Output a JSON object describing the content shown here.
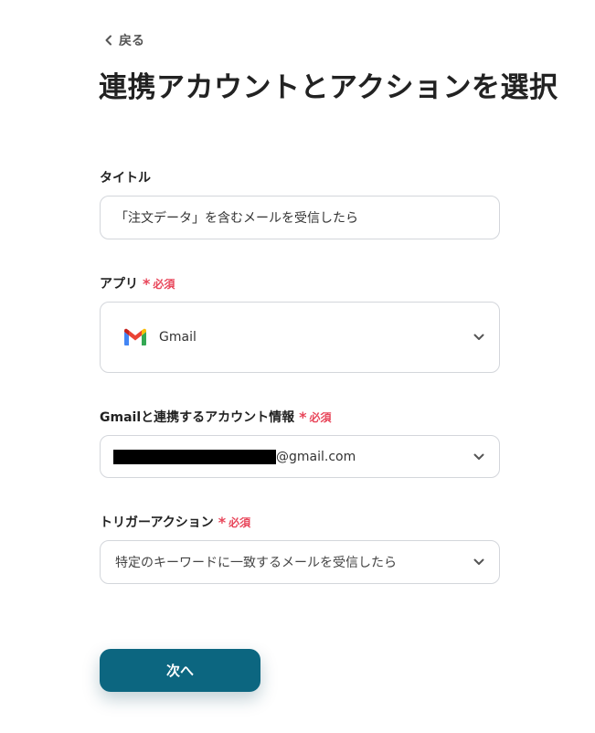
{
  "nav": {
    "back_label": "戻る"
  },
  "page": {
    "title": "連携アカウントとアクションを選択"
  },
  "form": {
    "title_field": {
      "label": "タイトル",
      "value": "「注文データ」を含むメールを受信したら"
    },
    "app_field": {
      "label": "アプリ",
      "required_mark": "*",
      "required_text": "必須",
      "selected_app": "Gmail",
      "app_icon": "gmail-logo-icon"
    },
    "account_field": {
      "label": "Gmailと連携するアカウント情報",
      "required_mark": "*",
      "required_text": "必須",
      "value_domain": "@gmail.com"
    },
    "trigger_field": {
      "label": "トリガーアクション",
      "required_mark": "*",
      "required_text": "必須",
      "value": "特定のキーワードに一致するメールを受信したら"
    }
  },
  "actions": {
    "next_label": "次へ"
  },
  "colors": {
    "primary_button": "#0c6680",
    "required": "#e8465a",
    "border": "#d3d6db"
  }
}
